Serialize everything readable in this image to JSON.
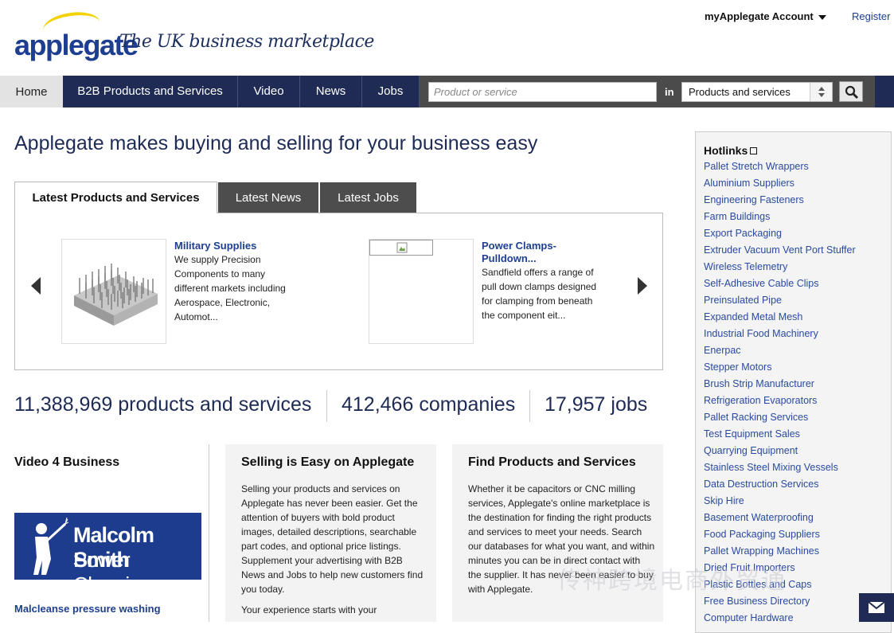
{
  "header": {
    "logo_text": "applegate",
    "tagline": "The UK business marketplace",
    "account_label": "myApplegate Account",
    "register_label": "Register"
  },
  "nav": {
    "home": "Home",
    "items": [
      "B2B Products and Services",
      "Video",
      "News",
      "Jobs"
    ],
    "search_placeholder": "Product or service",
    "in_label": "in",
    "select_value": "Products and services"
  },
  "main": {
    "headline": "Applegate makes buying and selling for your business easy",
    "tabs": [
      "Latest Products and Services",
      "Latest News",
      "Latest Jobs"
    ],
    "cards": [
      {
        "title": "Military Supplies",
        "text": [
          "We supply Precision",
          "Components to many",
          "different markets including",
          "Aerospace, Electronic,",
          "Automot..."
        ]
      },
      {
        "title": "Power Clamps-Pulldown...",
        "title_lines": [
          "Power Clamps-",
          "Pulldown..."
        ],
        "text": [
          "Sandfield offers a range of",
          "pull down clamps designed",
          "for clamping from beneath",
          "the component eit..."
        ]
      }
    ],
    "stats": [
      "11,388,969 products and services",
      "412,466 companies",
      "17,957 jobs"
    ]
  },
  "video": {
    "title": "Video 4 Business",
    "thumb_line1": "Malcolm Smith",
    "thumb_line2": "Power Cleaning",
    "link": "Malcleanse pressure washing"
  },
  "selling": {
    "title": "Selling is Easy on Applegate",
    "text": "Selling your products and services on Applegate has never been easier. Get the attention of buyers with bold product images, detailed descriptions, searchable part codes, and optional price listings. Supplement your advertising with B2B News and Jobs to help new customers find you today.",
    "text2": "Your experience starts with your"
  },
  "find": {
    "title": "Find Products and Services",
    "text": "Whether it be capacitors or CNC milling services, Applegate's online marketplace is the destination for finding the right products and services to meet your needs. Search our databases for what you want, and within minutes you can be in direct contact with the supplier. It has never been easier to buy with Applegate."
  },
  "sidebar": {
    "title": "Hotlinks",
    "items": [
      "Pallet Stretch Wrappers",
      "Aluminium Suppliers",
      "Engineering Fasteners",
      "Farm Buildings",
      "Export Packaging",
      "Extruder Vacuum Vent Port Stuffer",
      "Wireless Telemetry",
      "Self-Adhesive Cable Clips",
      "Preinsulated Pipe",
      "Expanded Metal Mesh",
      "Industrial Food Machinery",
      "Enerpac",
      "Stepper Motors",
      "Brush Strip Manufacturer",
      "Refrigeration Evaporators",
      "Pallet Racking Services",
      "Test Equipment Sales",
      "Quarrying Equipment",
      "Stainless Steel Mixing Vessels",
      "Data Destruction Services",
      "Skip Hire",
      "Basement Waterproofing",
      "Food Packaging Suppliers",
      "Pallet Wrapping Machines",
      "Dried Fruit Importers",
      "Plastic Bottles and Caps",
      "Free Business Directory",
      "Computer Hardware"
    ]
  },
  "watermark": "传神跨境电商外贸通",
  "colors": {
    "navy": "#1f2b55",
    "link": "#2a4aa0",
    "logo_yellow": "#f2d300"
  }
}
